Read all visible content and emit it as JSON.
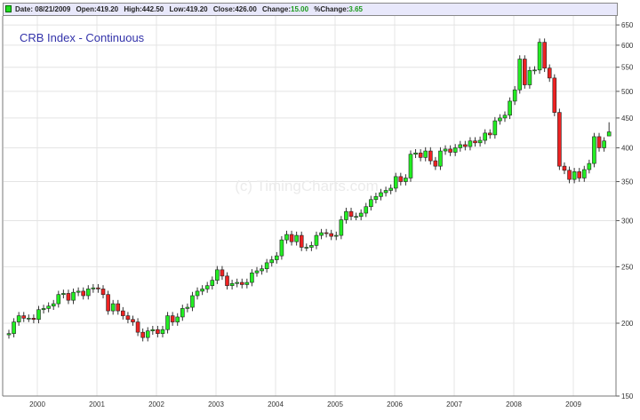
{
  "header": {
    "date_label": "Date:",
    "date": "08/21/2009",
    "open_label": "Open:",
    "open": "419.20",
    "high_label": "High:",
    "high": "442.50",
    "low_label": "Low:",
    "low": "419.20",
    "close_label": "Close:",
    "close": "426.00",
    "change_label": "Change:",
    "change": "15.00",
    "pct_change_label": "%Change:",
    "pct_change": "3.65"
  },
  "watermark": "(c) TimingCharts.com",
  "colors": {
    "up": "#22ee22",
    "down": "#ee2222",
    "title": "#3333aa",
    "grid": "#e4e4e4"
  },
  "chart_data": {
    "type": "candlestick",
    "title": "CRB Index - Continuous",
    "scale": "log",
    "ylim": [
      150,
      660
    ],
    "yticks": [
      150,
      200,
      250,
      300,
      350,
      400,
      450,
      500,
      550,
      600,
      650
    ],
    "xticks": [
      "2000",
      "2001",
      "2002",
      "2003",
      "2004",
      "2005",
      "2006",
      "2007",
      "2008",
      "2009"
    ],
    "start": "1999-07",
    "interval": "monthly",
    "grid": true,
    "close": [
      192,
      201,
      206,
      204,
      204,
      203,
      211,
      212,
      214,
      216,
      224,
      225,
      219,
      226,
      227,
      223,
      229,
      230,
      229,
      224,
      210,
      216,
      210,
      206,
      203,
      201,
      193,
      189,
      194,
      195,
      192,
      195,
      206,
      201,
      205,
      212,
      213,
      223,
      227,
      229,
      232,
      237,
      247,
      241,
      232,
      234,
      235,
      233,
      235,
      244,
      246,
      248,
      254,
      257,
      261,
      278,
      284,
      276,
      283,
      270,
      270,
      272,
      283,
      286,
      285,
      282,
      283,
      301,
      311,
      305,
      305,
      309,
      317,
      326,
      330,
      335,
      338,
      341,
      357,
      350,
      355,
      390,
      392,
      385,
      395,
      380,
      372,
      395,
      398,
      393,
      400,
      405,
      402,
      411,
      408,
      412,
      424,
      421,
      445,
      450,
      455,
      481,
      503,
      568,
      513,
      543,
      544,
      607,
      548,
      527,
      460,
      372,
      366,
      353,
      364,
      355,
      367,
      376,
      418,
      400,
      411,
      426
    ],
    "last_candle": {
      "open": 419.2,
      "high": 442.5,
      "low": 419.2,
      "close": 426.0
    }
  }
}
